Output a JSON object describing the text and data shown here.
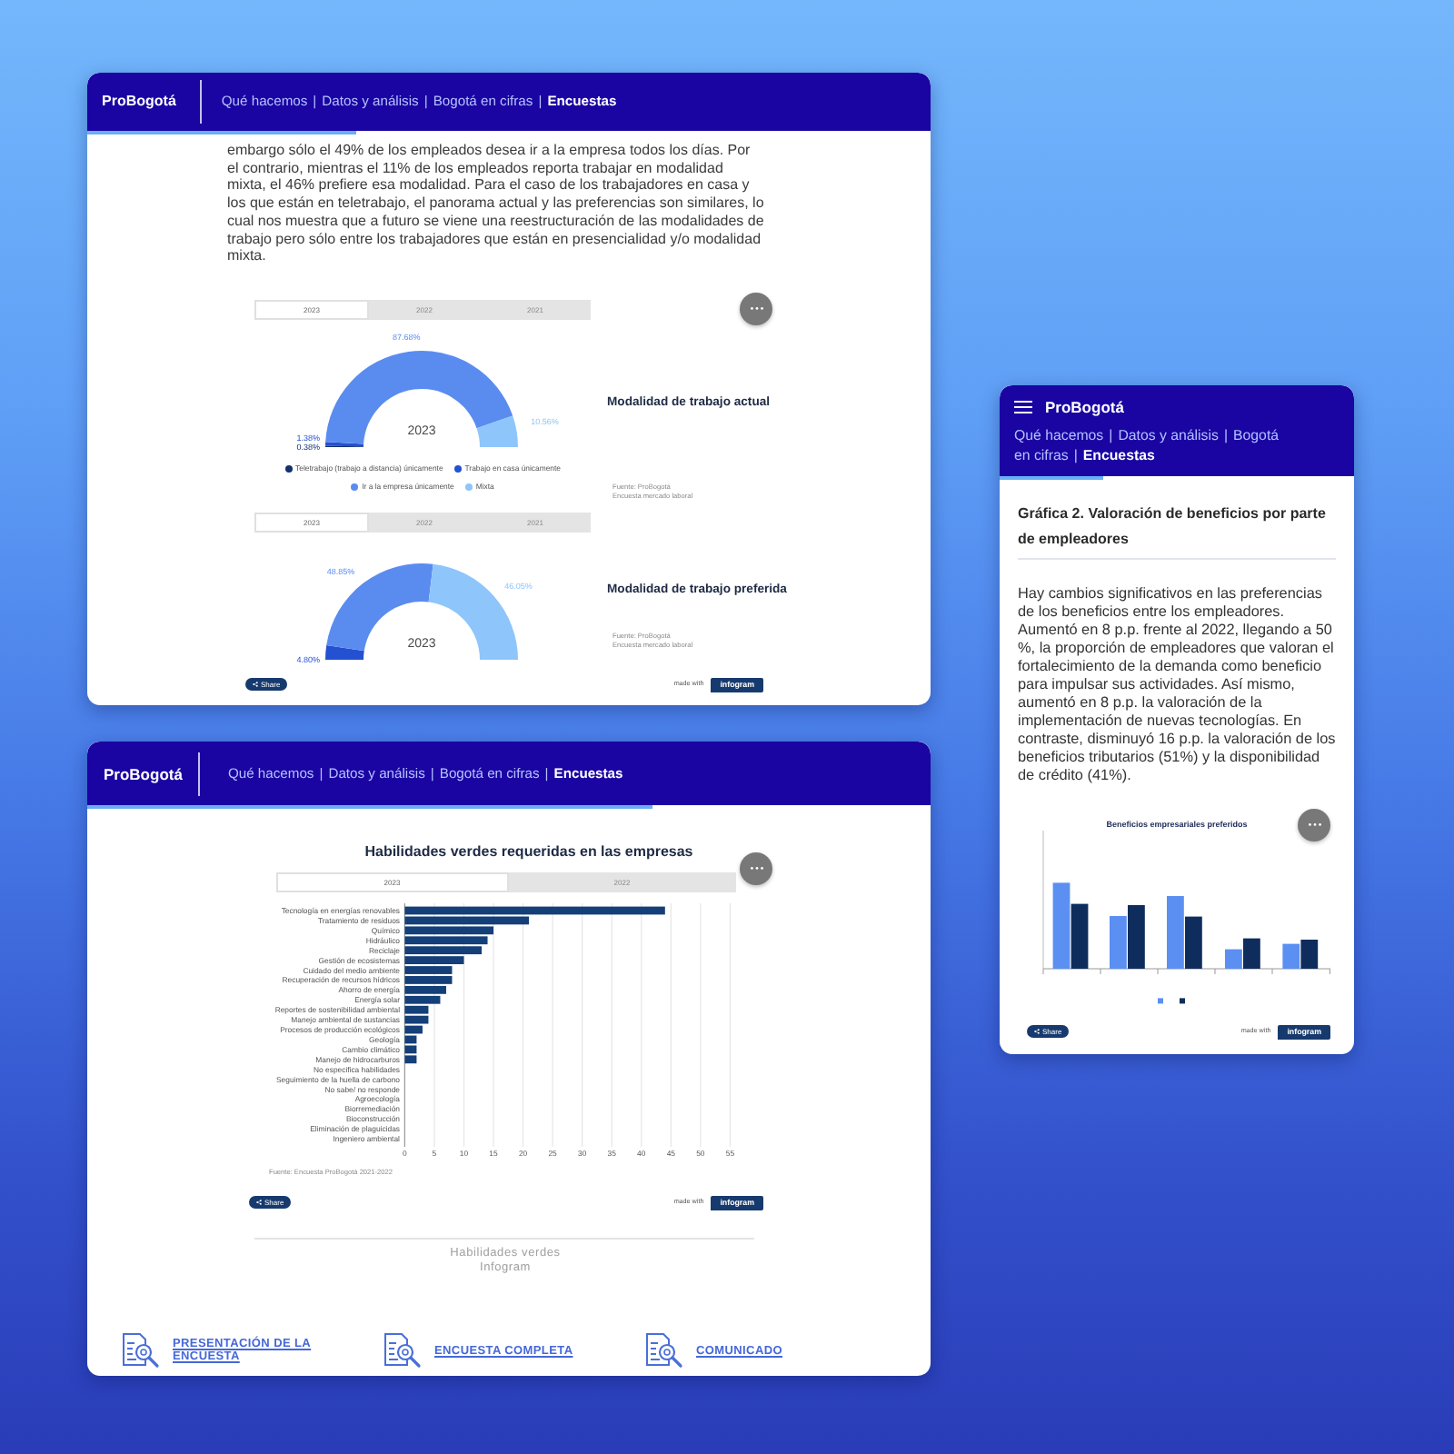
{
  "survey_window": {
    "header": {
      "logo": "ProBogotá",
      "nav": [
        {
          "label": "Qué hacemos",
          "selected": false
        },
        {
          "label": "Datos y análisis",
          "selected": false
        },
        {
          "label": "Bogotá en cifras",
          "selected": false
        },
        {
          "label": "Encuestas",
          "selected": true
        }
      ],
      "separators": [
        "|",
        "|",
        "|"
      ]
    },
    "reading_progress": {
      "level": 0.32
    },
    "paragraph": "embargo sólo el 49% de los empleados desea ir a la empresa todos los días. Por el contrario, mientras el 11% de los empleados reporta trabajar en modalidad mixta, el 46% prefiere esa modalidad. Para el caso de los trabajadores en casa y los que están en teletrabajo, el panorama actual y las preferencias son similares, lo cual nos muestra que a futuro se viene una reestructuración de las modalidades de trabajo pero sólo entre los trabajadores que están en presencialidad y/o modalidad mixta.",
    "gauges": [
      {
        "tabs": [
          {
            "label": "2023",
            "selected": true
          },
          {
            "label": "2022",
            "selected": false
          },
          {
            "label": "2021",
            "selected": false
          }
        ],
        "center_label": "2023",
        "heading": "Modalidad de trabajo actual",
        "source": [
          "Fuente: ProBogotá",
          "Encuesta mercado laboral"
        ],
        "chart_data": {
          "type": "donut",
          "categories": [
            "Teletrabajo (trabajo a distancia) únicamente",
            "Trabajo en casa únicamente",
            "Ir a la empresa únicamente",
            "Mixta"
          ],
          "values": [
            0.38,
            1.38,
            87.68,
            10.56
          ],
          "value_labels": [
            "0.38%",
            "1.38%",
            "87.68%",
            "10.56%"
          ]
        }
      },
      {
        "tabs": [
          {
            "label": "2023",
            "selected": true
          },
          {
            "label": "2022",
            "selected": false
          },
          {
            "label": "2021",
            "selected": false
          }
        ],
        "center_label": "2023",
        "heading": "Modalidad de trabajo preferida",
        "source": [
          "Fuente: ProBogotá",
          "Encuesta mercado laboral"
        ],
        "chart_data": {
          "type": "donut",
          "values": [
            4.8,
            48.85,
            46.05
          ],
          "value_labels": [
            "4.80%",
            "48.85%",
            "46.05%"
          ]
        }
      }
    ],
    "footer": {
      "share": "Share",
      "made_with": "made with",
      "brand": "infogram"
    }
  },
  "skills_window": {
    "header": {
      "logo": "ProBogotá",
      "nav": [
        {
          "label": "Qué hacemos",
          "selected": false
        },
        {
          "label": "Datos y análisis",
          "selected": false
        },
        {
          "label": "Bogotá en cifras",
          "selected": false
        },
        {
          "label": "Encuestas",
          "selected": true
        }
      ],
      "separators": [
        "|",
        "|",
        "|"
      ]
    },
    "reading_progress": {
      "level": 0.67
    },
    "chart_title": "Habilidades verdes requeridas en las empresas",
    "tabs": [
      {
        "label": "2023",
        "selected": true
      },
      {
        "label": "2022",
        "selected": false
      }
    ],
    "chart_data": {
      "type": "bar",
      "orientation": "horizontal",
      "grid": true,
      "categories": [
        "Tecnología en energías renovables",
        "Tratamiento de residuos",
        "Químico",
        "Hidráulico",
        "Reciclaje",
        "Gestión de ecosistemas",
        "Cuidado del medio ambiente",
        "Recuperación de recursos hídricos",
        "Ahorro de energía",
        "Energía solar",
        "Reportes de sostenibilidad ambiental",
        "Manejo ambiental de sustancias",
        "Procesos de producción ecológicos",
        "Geología",
        "Cambio climático",
        "Manejo de hidrocarburos",
        "No especifica habilidades",
        "Seguimiento de la huella de carbono",
        "No sabe/ no responde",
        "Agroecología",
        "Biorremediación",
        "Bioconstrucción",
        "Eliminación de plaguicidas",
        "Ingeniero ambiental"
      ],
      "values": [
        44,
        21,
        15,
        14,
        13,
        10,
        8,
        8,
        7,
        6,
        4,
        4,
        3,
        2,
        2,
        2,
        0,
        0,
        0,
        0,
        0,
        0,
        0,
        0
      ],
      "xlim": [
        0,
        55
      ],
      "xticks": [
        0,
        5,
        10,
        15,
        20,
        25,
        30,
        35,
        40,
        45,
        50,
        55
      ]
    },
    "source": "Fuente: Encuesta ProBogotá 2021-2022",
    "footer": {
      "share": "Share",
      "made_with": "made with",
      "brand": "infogram"
    },
    "caption": [
      "Habilidades verdes",
      "Infogram"
    ],
    "links": [
      {
        "label": "PRESENTACIÓN DE LA ENCUESTA"
      },
      {
        "label": "ENCUESTA COMPLETA"
      },
      {
        "label": "COMUNICADO"
      }
    ]
  },
  "benefits_window": {
    "header": {
      "logo": "ProBogotá",
      "nav": [
        {
          "label": "Qué hacemos",
          "selected": false
        },
        {
          "label": "Datos y análisis",
          "selected": false
        },
        {
          "label": "Bogotá en cifras",
          "selected": false
        },
        {
          "label": "Encuestas",
          "selected": true
        }
      ],
      "separators": [
        "|",
        "|",
        "|"
      ]
    },
    "reading_progress": {
      "level": 0.29
    },
    "title": "Gráfica 2. Valoración de beneficios por parte de empleadores",
    "paragraph": "Hay cambios significativos en las preferencias de los beneficios entre los empleadores. Aumentó en 8 p.p. frente al 2022, llegando a 50 %, la proporción de empleadores que valoran el fortalecimiento de la demanda como beneficio para impulsar sus actividades. Así mismo, aumentó en 8 p.p. la valoración de la implementación de nuevas tecnologías. En contraste, disminuyó 16 p.p. la valoración de los beneficios tributarios (51%) y la disponibilidad de crédito (41%).",
    "chart_title": "Beneficios empresariales preferidos",
    "footer": {
      "share": "Share",
      "made_with": "made with",
      "brand": "infogram"
    }
  }
}
